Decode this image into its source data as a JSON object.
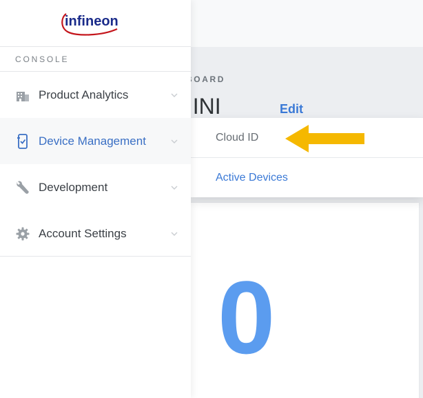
{
  "brand": {
    "logo_text": "infineon",
    "brand_color": "#1a2b8a",
    "swoosh_color": "#c4161c"
  },
  "sidebar": {
    "section_label": "CONSOLE",
    "items": [
      {
        "label": "Product Analytics",
        "icon": "building-icon",
        "active": false
      },
      {
        "label": "Device Management",
        "icon": "device-icon",
        "active": true
      },
      {
        "label": "Development",
        "icon": "wrench-icon",
        "active": false
      },
      {
        "label": "Account Settings",
        "icon": "gear-icon",
        "active": false
      }
    ]
  },
  "submenu": {
    "items": [
      {
        "label": "Cloud ID"
      },
      {
        "label": "Active Devices"
      }
    ],
    "annotation": "arrow-pointer",
    "annotation_color": "#f5b800"
  },
  "main": {
    "section_label": "BOARD",
    "title": "t INI",
    "edit_label": "Edit",
    "stat_value": "0"
  },
  "colors": {
    "accent": "#3a79d6",
    "stat": "#5b9cef",
    "text": "#3b4046",
    "muted": "#7b8187"
  }
}
